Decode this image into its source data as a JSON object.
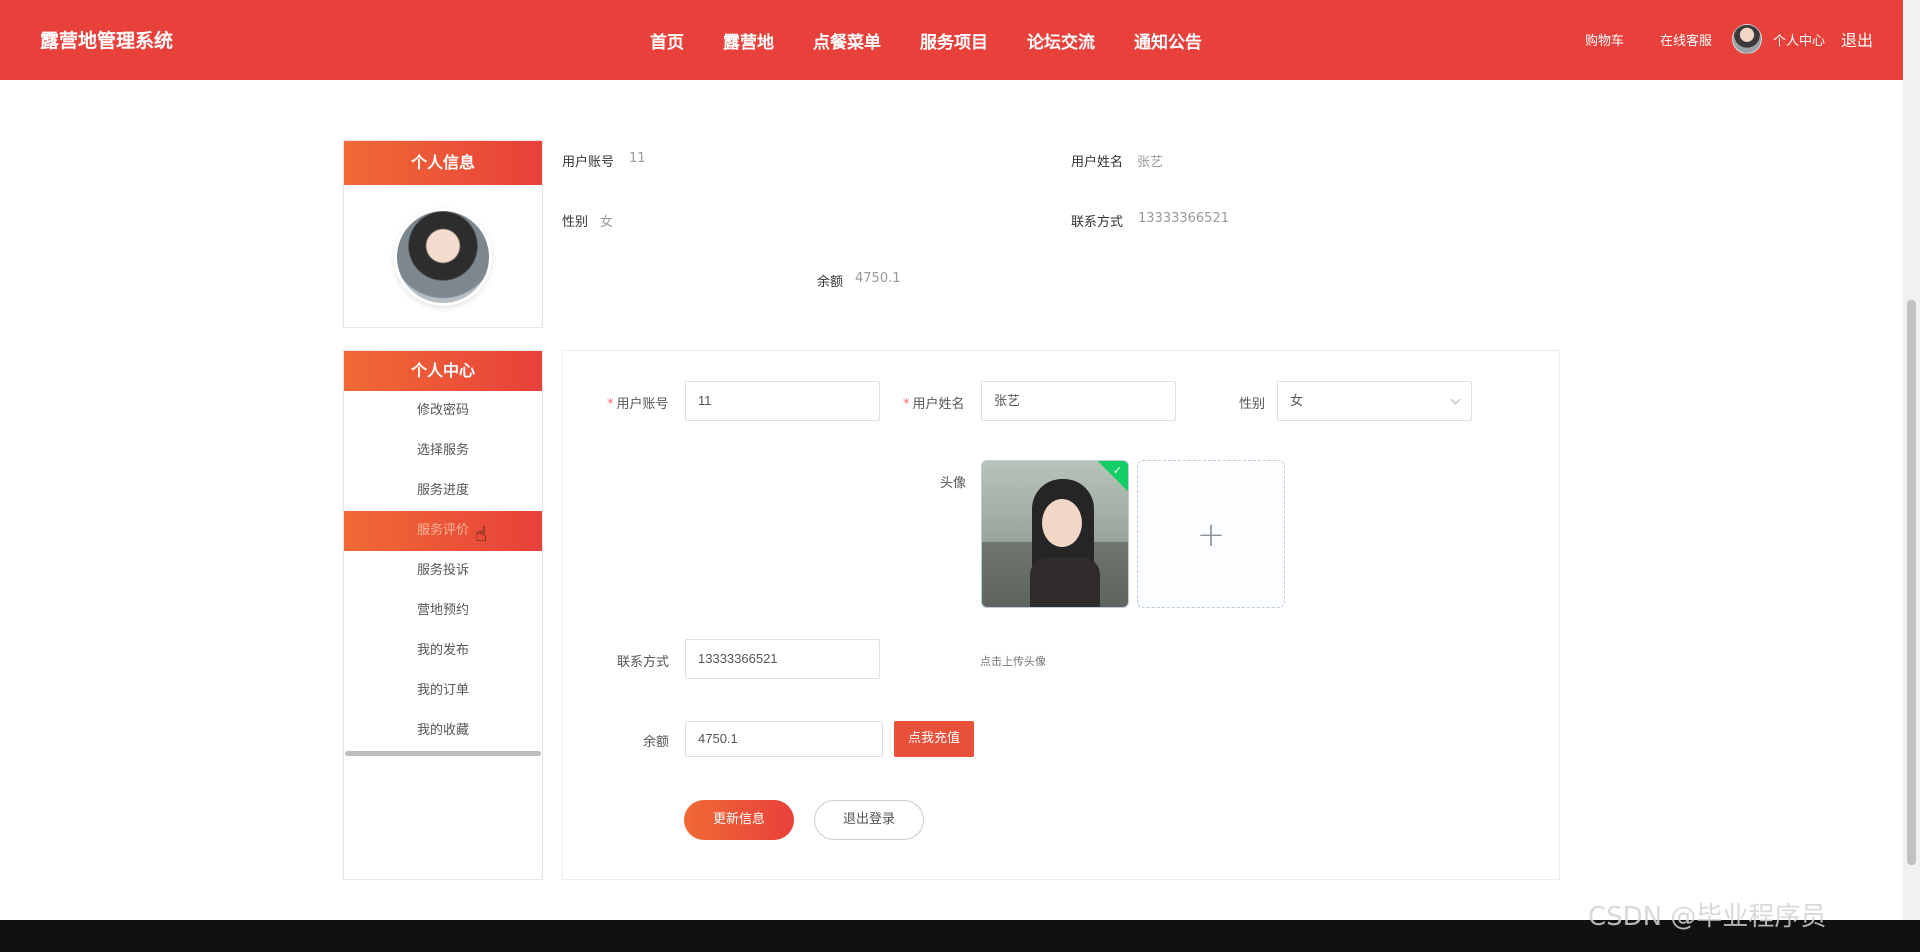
{
  "header": {
    "brand": "露营地管理系统",
    "nav": [
      "首页",
      "露营地",
      "点餐菜单",
      "服务项目",
      "论坛交流",
      "通知公告"
    ],
    "cart": "购物车",
    "support": "在线客服",
    "user_center": "个人中心",
    "logout": "退出"
  },
  "sidebar": {
    "profile_title": "个人信息",
    "menu_title": "个人中心",
    "menu": [
      "修改密码",
      "选择服务",
      "服务进度",
      "服务评价",
      "服务投诉",
      "营地预约",
      "我的发布",
      "我的订单",
      "我的收藏"
    ],
    "active_index": 3
  },
  "info": {
    "account_label": "用户账号",
    "account_value": "11",
    "name_label": "用户姓名",
    "name_value": "张艺",
    "gender_label": "性别",
    "gender_value": "女",
    "phone_label": "联系方式",
    "phone_value": "13333366521",
    "balance_label": "余额",
    "balance_value": "4750.1"
  },
  "form": {
    "account_label": "用户账号",
    "account_value": "11",
    "name_label": "用户姓名",
    "name_value": "张艺",
    "gender_label": "性别",
    "gender_value": "女",
    "avatar_label": "头像",
    "upload_tip": "点击上传头像",
    "phone_label": "联系方式",
    "phone_value": "13333366521",
    "balance_label": "余额",
    "balance_value": "4750.1",
    "recharge_button": "点我充值",
    "update_button": "更新信息",
    "logout_button": "退出登录",
    "plus_symbol": "+"
  },
  "watermark": "CSDN @毕业程序员"
}
